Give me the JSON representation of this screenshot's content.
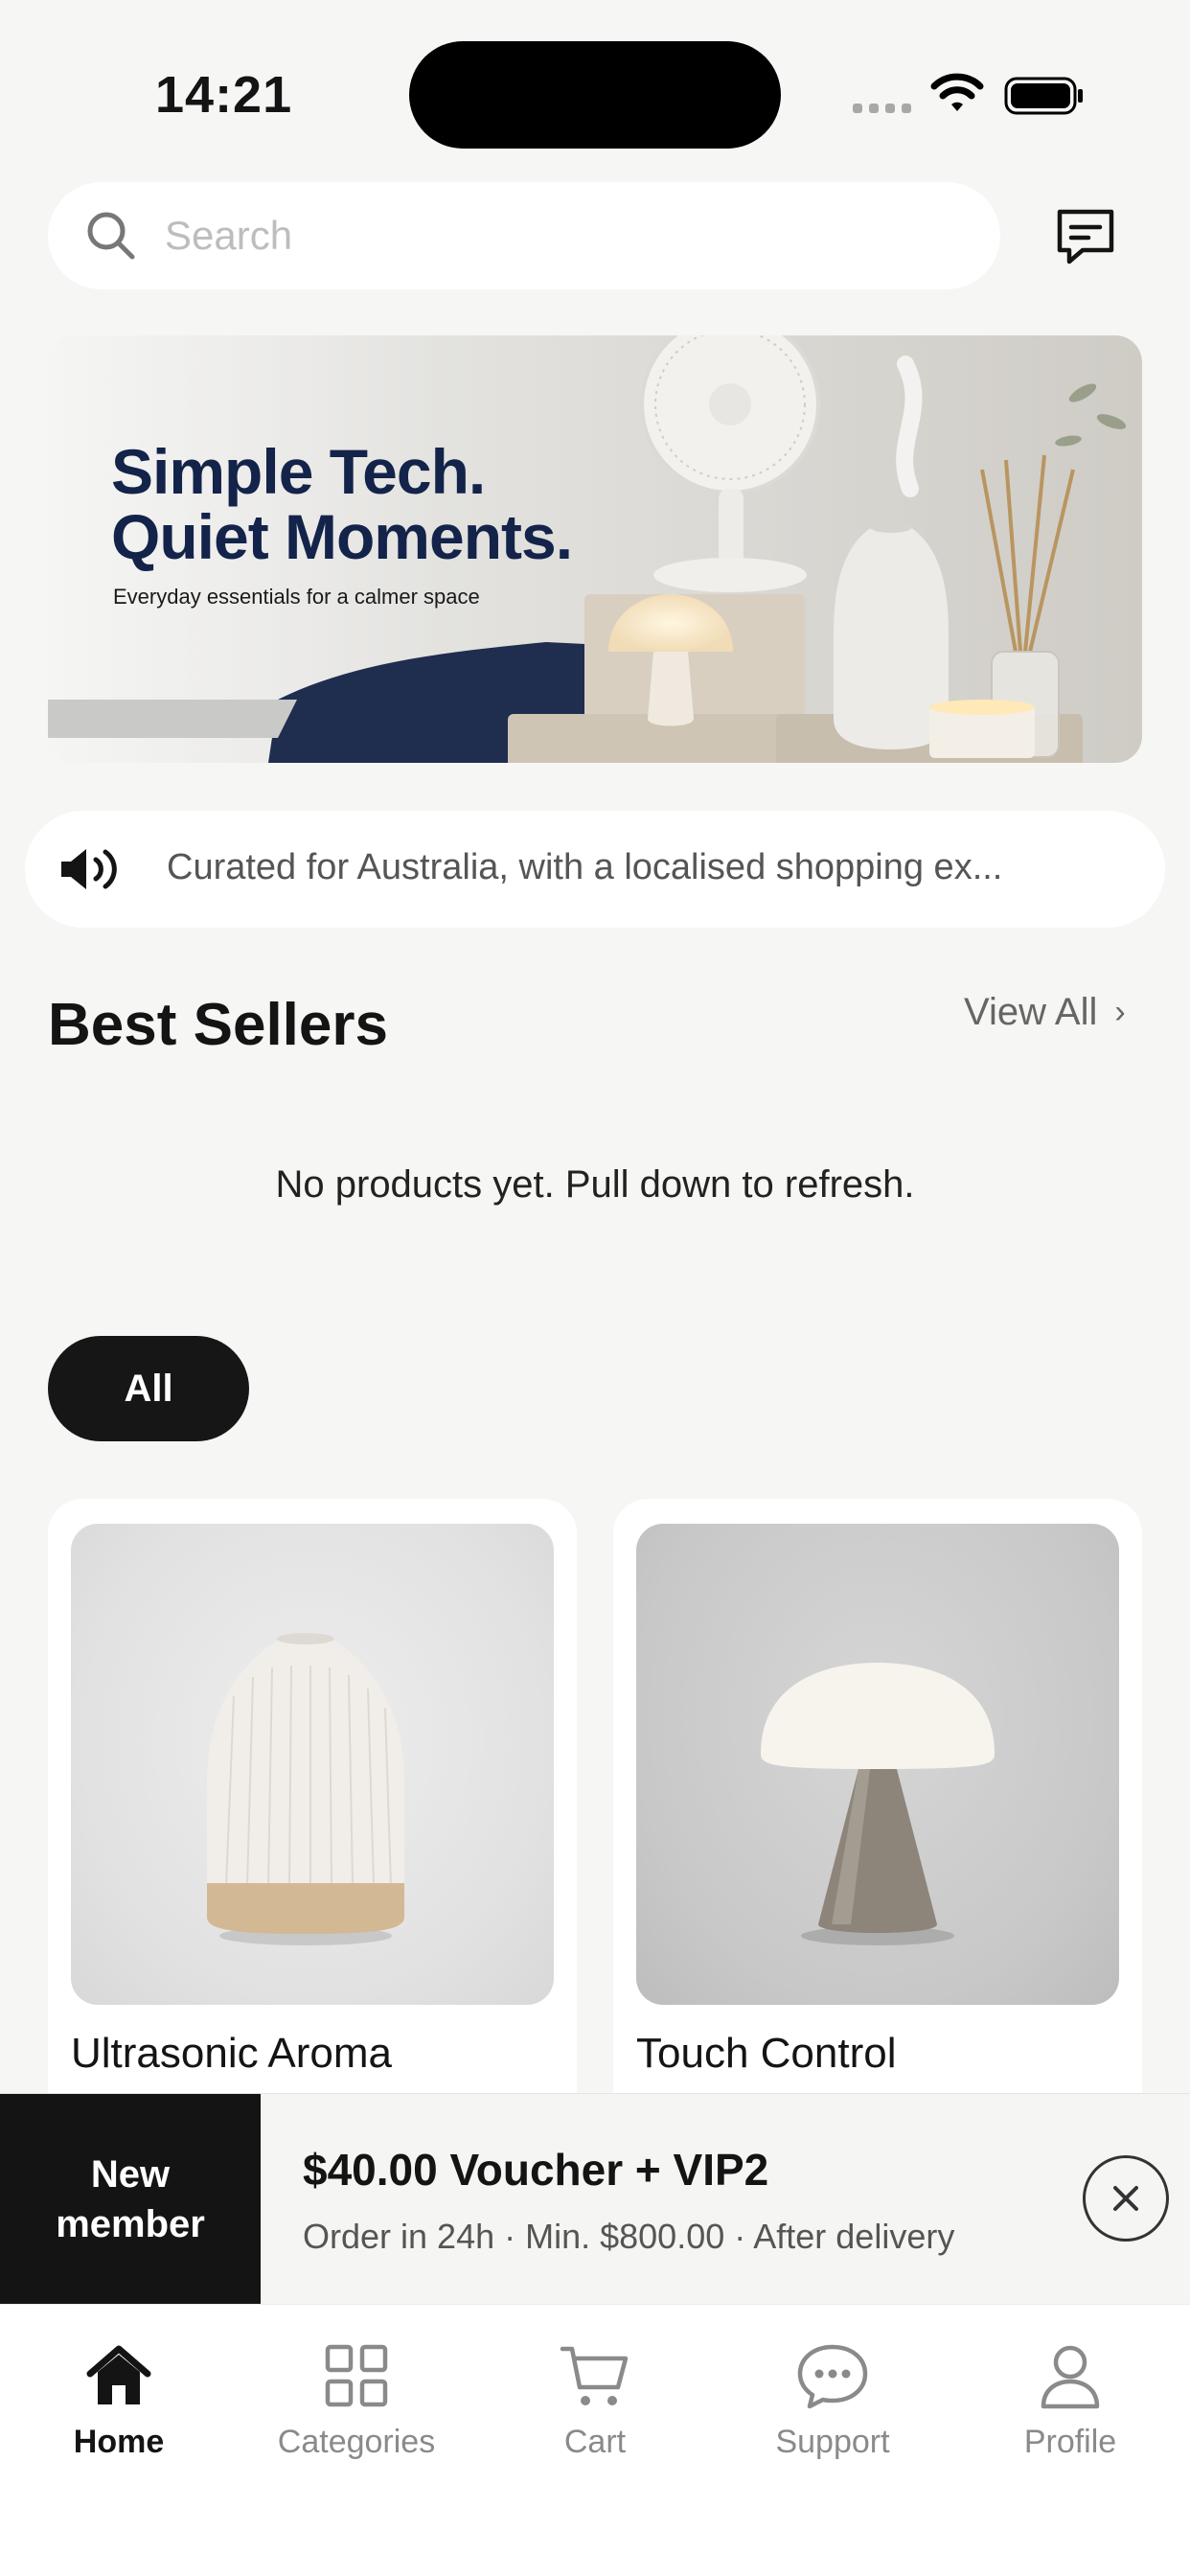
{
  "status_bar": {
    "time": "14:21"
  },
  "search": {
    "placeholder": "Search"
  },
  "banner": {
    "title": "Simple Tech.\nQuiet Moments.",
    "subtitle": "Everyday essentials for a calmer space"
  },
  "announcement": {
    "text": "Curated for Australia, with a localised shopping ex..."
  },
  "best_sellers": {
    "title": "Best Sellers",
    "view_all": "View All",
    "view_all_chevron": "›",
    "empty_message": "No products yet. Pull down to refresh."
  },
  "filters": [
    {
      "label": "All",
      "selected": true
    }
  ],
  "products": [
    {
      "title": "Ultrasonic Aroma",
      "image": "ceramic-aroma-diffuser"
    },
    {
      "title": "Touch Control",
      "image": "mushroom-lamp"
    }
  ],
  "voucher": {
    "badge": "New\nmember",
    "title": "$40.00 Voucher + VIP2",
    "subtitle": "Order in 24h · Min. $800.00 · After delivery"
  },
  "tabs": [
    {
      "label": "Home",
      "icon": "home-icon",
      "active": true
    },
    {
      "label": "Categories",
      "icon": "grid-icon",
      "active": false
    },
    {
      "label": "Cart",
      "icon": "cart-icon",
      "active": false
    },
    {
      "label": "Support",
      "icon": "chat-bubble-icon",
      "active": false
    },
    {
      "label": "Profile",
      "icon": "person-icon",
      "active": false
    }
  ],
  "colors": {
    "accent": "#141414",
    "background": "#f6f6f4",
    "banner_text": "#13234a"
  }
}
